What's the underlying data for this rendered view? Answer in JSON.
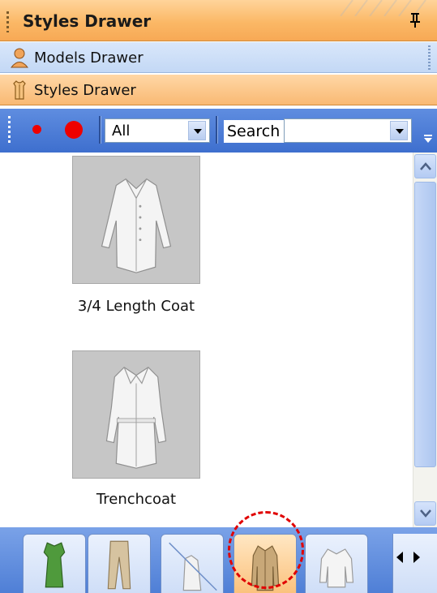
{
  "title_bar": {
    "title": "Styles Drawer",
    "pin_icon": "pin-icon"
  },
  "drawers": [
    {
      "label": "Models Drawer",
      "icon": "person-icon"
    },
    {
      "label": "Styles Drawer",
      "icon": "garment-icon"
    }
  ],
  "toolbar": {
    "filter_selected": "All",
    "search_label": "Search",
    "search_value": ""
  },
  "items": [
    {
      "caption": "3/4 Length Coat",
      "thumbnail": "long-coat-thumbnail"
    },
    {
      "caption": "Trenchcoat",
      "thumbnail": "trenchcoat-thumbnail"
    }
  ],
  "tabs": [
    {
      "icon": "green-dress-icon"
    },
    {
      "icon": "beige-pants-icon"
    },
    {
      "icon": "white-top-icon"
    },
    {
      "icon": "beige-coat-icon",
      "active": true
    },
    {
      "icon": "white-jacket-icon"
    }
  ],
  "colors": {
    "title_orange": "#fbb866",
    "drawer_blue": "#c3d8f5",
    "toolbar_blue": "#3e6fce",
    "record_red": "#ee0000",
    "highlight_red": "#e00000"
  }
}
